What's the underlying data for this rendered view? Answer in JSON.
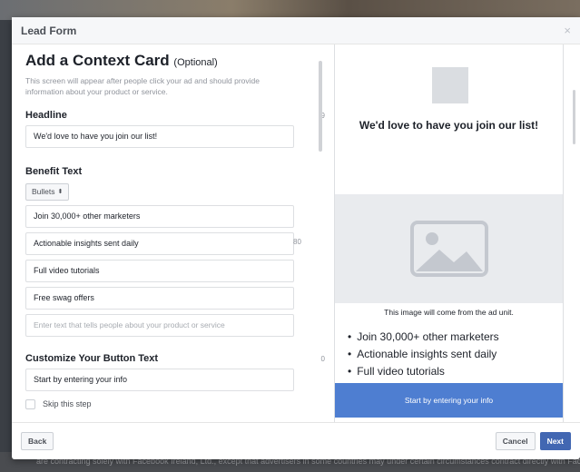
{
  "dialog": {
    "title": "Lead Form",
    "close": "×"
  },
  "context_card": {
    "title": "Add a Context Card",
    "optional": "(Optional)",
    "description": "This screen will appear after people click your ad and should provide information about your product or service.",
    "headline": {
      "label": "Headline",
      "counter": "9",
      "value": "We'd love to have you join our list!"
    },
    "benefit": {
      "label": "Benefit Text",
      "layout": "Bullets",
      "counter": "80",
      "items": [
        "Join 30,000+ other marketers",
        "Actionable insights sent daily",
        "Full video tutorials",
        "Free swag offers"
      ],
      "placeholder": "Enter text that tells people about your product or service"
    },
    "button": {
      "label": "Customize Your Button Text",
      "counter": "0",
      "value": "Start by entering your info"
    },
    "skip_label": "Skip this step"
  },
  "preview": {
    "headline": "We'd love to have you join our list!",
    "caption": "This image will come from the ad unit.",
    "bullets": [
      "Join 30,000+ other marketers",
      "Actionable insights sent daily",
      "Full video tutorials"
    ],
    "cta": "Start by entering your info"
  },
  "footer": {
    "back": "Back",
    "cancel": "Cancel",
    "next": "Next"
  },
  "background": {
    "footer_text": "are contracting solely with Facebook Ireland, Ltd., except that advertisers in some countries may under certain circumstances contract directly with Facebook"
  },
  "colors": {
    "primary": "#4267b2",
    "cta": "#4e7ed1"
  }
}
